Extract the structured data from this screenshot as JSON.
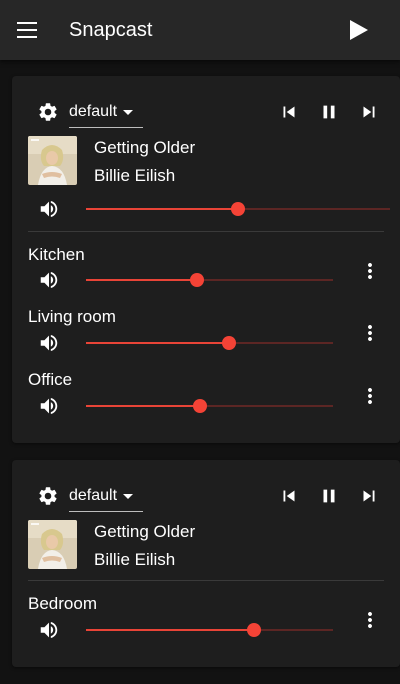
{
  "appbar": {
    "title": "Snapcast",
    "menu_icon": "menu-icon",
    "play_icon": "play-icon"
  },
  "colors": {
    "accent": "#f44336",
    "card": "#1e1e1e",
    "appbar": "#272727",
    "background": "#121212"
  },
  "groups": [
    {
      "stream": "default",
      "track": {
        "title": "Getting Older",
        "artist": "Billie Eilish"
      },
      "group_volume_percent": 50,
      "clients": [
        {
          "name": "Kitchen",
          "volume_percent": 45
        },
        {
          "name": "Living room",
          "volume_percent": 58
        },
        {
          "name": "Office",
          "volume_percent": 46
        }
      ]
    },
    {
      "stream": "default",
      "track": {
        "title": "Getting Older",
        "artist": "Billie Eilish"
      },
      "clients": [
        {
          "name": "Bedroom",
          "volume_percent": 68
        }
      ]
    }
  ]
}
